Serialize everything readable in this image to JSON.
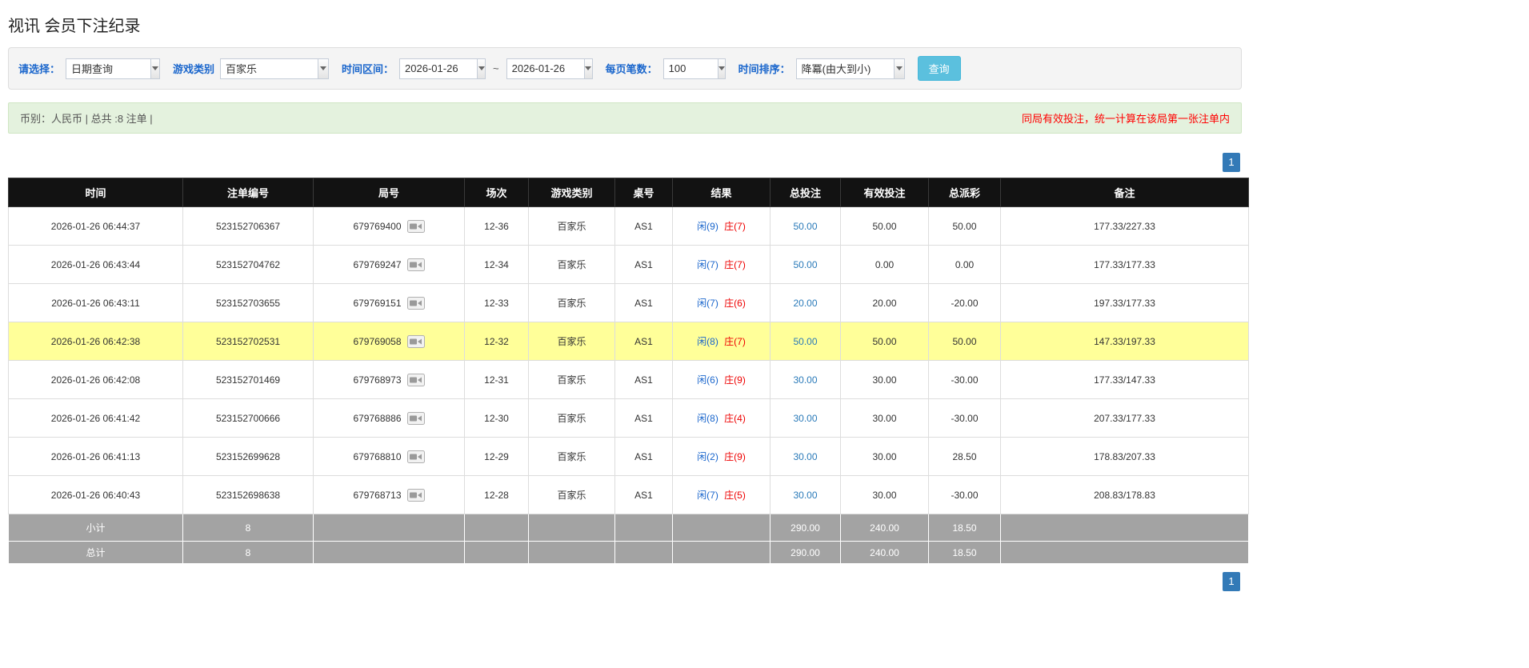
{
  "page": {
    "title": "视讯 会员下注纪录"
  },
  "filters": {
    "select_label": "请选择：",
    "select_value": "日期查询",
    "game_type_label": "游戏类别",
    "game_type_value": "百家乐",
    "date_range_label": "时间区间：",
    "date_from": "2026-01-26",
    "date_to": "2026-01-26",
    "range_separator": "~",
    "page_size_label": "每页笔数：",
    "page_size_value": "100",
    "sort_label": "时间排序：",
    "sort_value": "降冪(由大到小)",
    "search_button_label": "查询"
  },
  "summary": {
    "info": "币别：人民币 | 总共 :8 注单 |",
    "warning": "同局有效投注，统一计算在该局第一张注单内"
  },
  "pagination": {
    "current_page": "1"
  },
  "icons": {
    "dropdown": "chevron-down-icon",
    "round_video": "video-replay-icon"
  },
  "colors": {
    "header_bg": "#121212",
    "highlight_row": "#ffff99",
    "footer_bg": "#a3a3a3",
    "link_blue": "#2a7ab9",
    "player_blue": "#1a66cc",
    "banker_red": "#ee0000",
    "negative_red": "#ee0000",
    "warning_red": "#ff0000",
    "search_button_bg": "#5bc0de",
    "pager_blue": "#337ab7",
    "summary_bg": "#e4f2de"
  },
  "table": {
    "headers": [
      "时间",
      "注单编号",
      "局号",
      "场次",
      "游戏类别",
      "桌号",
      "结果",
      "总投注",
      "有效投注",
      "总派彩",
      "备注"
    ],
    "rows": [
      {
        "time": "2026-01-26 06:44:37",
        "bet_id": "523152706367",
        "round": "679769400",
        "session": "12-36",
        "game": "百家乐",
        "table_no": "AS1",
        "result_player": "闲(9)",
        "result_banker": "庄(7)",
        "total_bet": "50.00",
        "valid_bet": "50.00",
        "payout": "50.00",
        "note": "177.33/227.33",
        "highlight": false
      },
      {
        "time": "2026-01-26 06:43:44",
        "bet_id": "523152704762",
        "round": "679769247",
        "session": "12-34",
        "game": "百家乐",
        "table_no": "AS1",
        "result_player": "闲(7)",
        "result_banker": "庄(7)",
        "total_bet": "50.00",
        "valid_bet": "0.00",
        "payout": "0.00",
        "note": "177.33/177.33",
        "highlight": false
      },
      {
        "time": "2026-01-26 06:43:11",
        "bet_id": "523152703655",
        "round": "679769151",
        "session": "12-33",
        "game": "百家乐",
        "table_no": "AS1",
        "result_player": "闲(7)",
        "result_banker": "庄(6)",
        "total_bet": "20.00",
        "valid_bet": "20.00",
        "payout": "-20.00",
        "note": "197.33/177.33",
        "highlight": false
      },
      {
        "time": "2026-01-26 06:42:38",
        "bet_id": "523152702531",
        "round": "679769058",
        "session": "12-32",
        "game": "百家乐",
        "table_no": "AS1",
        "result_player": "闲(8)",
        "result_banker": "庄(7)",
        "total_bet": "50.00",
        "valid_bet": "50.00",
        "payout": "50.00",
        "note": "147.33/197.33",
        "highlight": true
      },
      {
        "time": "2026-01-26 06:42:08",
        "bet_id": "523152701469",
        "round": "679768973",
        "session": "12-31",
        "game": "百家乐",
        "table_no": "AS1",
        "result_player": "闲(6)",
        "result_banker": "庄(9)",
        "total_bet": "30.00",
        "valid_bet": "30.00",
        "payout": "-30.00",
        "note": "177.33/147.33",
        "highlight": false
      },
      {
        "time": "2026-01-26 06:41:42",
        "bet_id": "523152700666",
        "round": "679768886",
        "session": "12-30",
        "game": "百家乐",
        "table_no": "AS1",
        "result_player": "闲(8)",
        "result_banker": "庄(4)",
        "total_bet": "30.00",
        "valid_bet": "30.00",
        "payout": "-30.00",
        "note": "207.33/177.33",
        "highlight": false
      },
      {
        "time": "2026-01-26 06:41:13",
        "bet_id": "523152699628",
        "round": "679768810",
        "session": "12-29",
        "game": "百家乐",
        "table_no": "AS1",
        "result_player": "闲(2)",
        "result_banker": "庄(9)",
        "total_bet": "30.00",
        "valid_bet": "30.00",
        "payout": "28.50",
        "note": "178.83/207.33",
        "highlight": false
      },
      {
        "time": "2026-01-26 06:40:43",
        "bet_id": "523152698638",
        "round": "679768713",
        "session": "12-28",
        "game": "百家乐",
        "table_no": "AS1",
        "result_player": "闲(7)",
        "result_banker": "庄(5)",
        "total_bet": "30.00",
        "valid_bet": "30.00",
        "payout": "-30.00",
        "note": "208.83/178.83",
        "highlight": false
      }
    ],
    "subtotal": {
      "label": "小计",
      "count": "8",
      "total_bet": "290.00",
      "valid_bet": "240.00",
      "payout": "18.50"
    },
    "total": {
      "label": "总计",
      "count": "8",
      "total_bet": "290.00",
      "valid_bet": "240.00",
      "payout": "18.50"
    }
  }
}
